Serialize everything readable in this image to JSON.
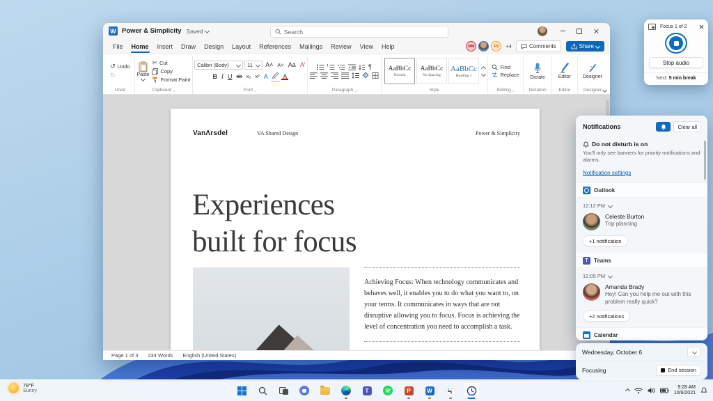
{
  "icons": {
    "word": "W",
    "powerpoint": "P",
    "teams": "T"
  },
  "window": {
    "titlebar": {
      "title": "Power & Simplicity",
      "saved": "Saved",
      "search": "Search"
    },
    "menu": {
      "tabs": [
        "File",
        "Home",
        "Insert",
        "Draw",
        "Design",
        "Layout",
        "References",
        "Mailings",
        "Review",
        "View",
        "Help"
      ],
      "active_tab": "Home",
      "collab": {
        "badge1": "MM",
        "badge2": "FS",
        "more": "+4"
      },
      "comments": "Comments",
      "share": "Share"
    },
    "ribbon": {
      "undo": {
        "undo": "Undo",
        "label": "Undo"
      },
      "clipboard": {
        "paste": "Paste",
        "cut": "Cut",
        "copy": "Copy",
        "format_painter": "Format Paint",
        "label": "Clipboard"
      },
      "font": {
        "family": "Calibri (Body)",
        "size": "11",
        "bold": "B",
        "italic": "I",
        "underline": "U",
        "strike": "ab",
        "sub": "x₂",
        "sup": "x²",
        "label": "Font"
      },
      "paragraph": {
        "pilcrow": "¶",
        "label": "Paragraph"
      },
      "style": {
        "items": [
          {
            "preview": "AaBbCc",
            "name": "Normal"
          },
          {
            "preview": "AaBbCc",
            "name": "No Spacing"
          },
          {
            "preview": "AaBbCc",
            "name": "Heading 1"
          }
        ],
        "label": "Style"
      },
      "editing": {
        "find": "Find",
        "replace": "Replace",
        "label": "Editing"
      },
      "dictation": {
        "button": "Dictate",
        "label": "Dictation"
      },
      "editor": {
        "button": "Editor",
        "label": "Editor"
      },
      "designer": {
        "button": "Designer",
        "label": "Designer"
      }
    },
    "doc": {
      "logo": "VanΛrsdel",
      "center": "VA Shared Design",
      "right": "Power & Simplicity",
      "h1a": "Experiences",
      "h1b": "built for focus",
      "body": "Achieving Focus: When technology communicates and behaves well, it enables you to do what you want to, on your terms. It communicates in ways that are not disruptive allowing you to focus. Focus is achieving the level of concentration you need to accomplish a task."
    },
    "status": {
      "page": "Page 1 of 3",
      "words": "234 Words",
      "lang": "English (United States)"
    }
  },
  "focus_widget": {
    "title": "Focus 1 of 2",
    "stop": "Stop audio",
    "next_label": "Next:",
    "next": "5 min break"
  },
  "notifications": {
    "title": "Notifications",
    "clear": "Clear all",
    "dnd_title": "Do not disturb is on",
    "dnd_desc": "You'll only see banners for priority notifications and alarms.",
    "settings": "Notification settings",
    "outlook": {
      "app": "Outlook",
      "time": "12:12 PM",
      "name": "Celeste Burton",
      "msg": "Trip planning",
      "more": "+1 notification"
    },
    "teams": {
      "app": "Teams",
      "time": "12:05 PM",
      "name": "Amanda Brady",
      "msg": "Hey! Can you help me out with this problem really quick?",
      "more": "+2 notifications"
    },
    "calendar": {
      "app": "Calendar"
    }
  },
  "day_widget": {
    "date": "Wednesday, October 6",
    "status": "Focusing",
    "end": "End session"
  },
  "taskbar": {
    "temp": "78°F",
    "cond": "Sunny",
    "time": "9:28 AM",
    "date": "10/6/2021"
  },
  "colors": {
    "accent": "#0f6cbd",
    "word_blue": "#185abd",
    "teams_purple": "#4f55bd",
    "spotify_green": "#1ed760",
    "ppt_orange": "#d35230",
    "link_blue": "#0b5cab"
  }
}
